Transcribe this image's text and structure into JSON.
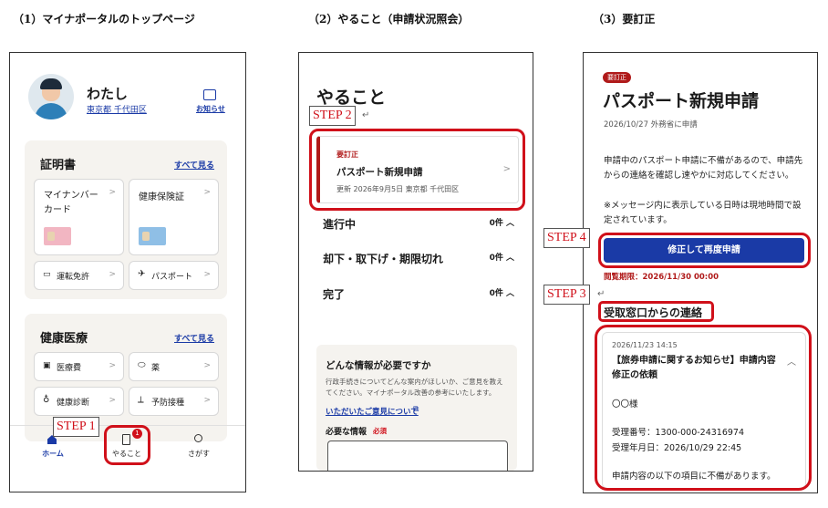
{
  "captions": {
    "panel1": "（1）マイナポータルのトップページ",
    "panel2": "（2）やること（申請状況照会）",
    "panel3": "（3）要訂正"
  },
  "steps": {
    "s1": "STEP 1",
    "s2": "STEP 2",
    "s3": "STEP 3",
    "s4": "STEP 4"
  },
  "panel1": {
    "user_name": "わたし",
    "user_location": "東京都 千代田区",
    "notice_label": "お知らせ",
    "certificates": {
      "title": "証明書",
      "see_all": "すべて見る",
      "mynumber_card": "マイナンバーカード",
      "health_insurance": "健康保険証",
      "drivers_license": "運転免許",
      "passport": "パスポート"
    },
    "health": {
      "title": "健康医療",
      "see_all": "すべて見る",
      "medical_costs": "医療費",
      "medicine": "薬",
      "health_checkup": "健康診断",
      "vaccination": "予防接種"
    },
    "nav": {
      "home": "ホーム",
      "todo": "やること",
      "search": "さがす",
      "todo_badge": "1"
    }
  },
  "panel2": {
    "title": "やること",
    "item": {
      "status": "要訂正",
      "name": "パスポート新規申請",
      "updated": "更新 2026年9月5日 東京都 千代田区"
    },
    "rows": [
      {
        "label": "進行中",
        "count": "0件"
      },
      {
        "label": "却下・取下げ・期限切れ",
        "count": "0件"
      },
      {
        "label": "完了",
        "count": "0件"
      }
    ],
    "feedback": {
      "title": "どんな情報が必要ですか",
      "body": "行政手続きについてどんな案内がほしいか、ご意見を教えてください。マイナポータル改善の参考にいたします。",
      "link": "いただいたご意見について",
      "field_label": "必要な情報",
      "required": "必須"
    }
  },
  "panel3": {
    "status_badge": "要訂正",
    "title": "パスポート新規申請",
    "sub": "2026/10/27 外務省に申請",
    "desc": "申請中のパスポート申請に不備があるので、申請先からの連絡を確認し速やかに対応してください。",
    "note": "※メッセージ内に表示している日時は現地時間で設定されています。",
    "button": "修正して再度申請",
    "deadline": "閲覧期限：2026/11/30 00:00",
    "contact_heading": "受取窓口からの連絡",
    "message": {
      "datetime": "2026/11/23 14:15",
      "subject": "【旅券申請に関するお知らせ】申請内容修正の依頼",
      "salutation": "〇〇様",
      "receipt_no": "受理番号：1300-000-24316974",
      "receipt_date": "受理年月日：2026/10/29 22:45",
      "body": "申請内容の以下の項目に不備があります。"
    }
  },
  "colors": {
    "accent_red": "#d0101a",
    "primary_blue": "#1a3aa6"
  }
}
